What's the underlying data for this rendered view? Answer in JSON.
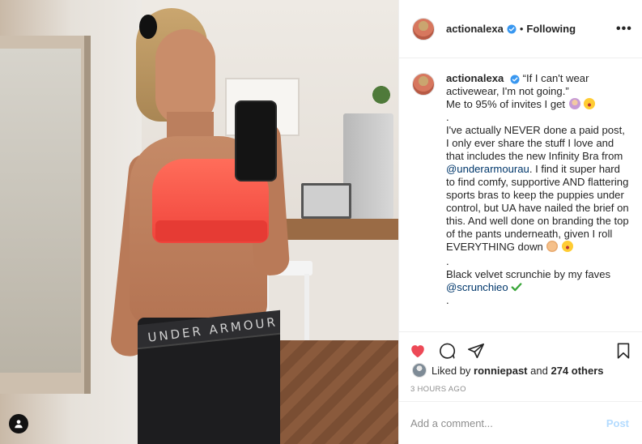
{
  "colors": {
    "accent_blue": "#0095f6",
    "link_blue": "#00376b",
    "like_red": "#ed4956",
    "post_button_disabled": "#b3dbff",
    "muted_gray": "#8e8e8e"
  },
  "post": {
    "watermark_text": "actionalexa",
    "leggings_text": "UNDER ARMOUR",
    "author": {
      "username": "actionalexa",
      "verified": true,
      "follow_state": "Following"
    },
    "header": {
      "separator": "•",
      "more_icon": "more-horizontal-icon"
    },
    "caption": {
      "username": "actionalexa",
      "line1": "“If I can't wear activewear, I'm not going.”",
      "line2": "Me to 95% of invites I get",
      "dot1": ".",
      "para1_a": "I've actually NEVER done a paid post, I only ever share the stuff I love and that includes the new Infinity Bra from",
      "mention1": "@underarmourau",
      "para1_b": ". I find it super hard to find comfy, supportive AND flattering sports bras to keep the puppies under control, but UA have nailed the brief on this. And well done on branding the top of the pants underneath, given I roll EVERYTHING down",
      "dot2": ".",
      "para2": "Black velvet scrunchie by my faves",
      "mention2": "@scrunchieo",
      "dot3": "."
    },
    "actions": {
      "like_icon": "heart-filled-icon",
      "comment_icon": "comment-icon",
      "share_icon": "share-paper-plane-icon",
      "save_icon": "bookmark-icon",
      "liked": true
    },
    "likes": {
      "prefix": "Liked by",
      "user": "ronniepast",
      "joiner": "and",
      "others": "274 others"
    },
    "timestamp": "3 HOURS AGO",
    "comment_box": {
      "placeholder": "Add a comment...",
      "post_label": "Post"
    }
  }
}
